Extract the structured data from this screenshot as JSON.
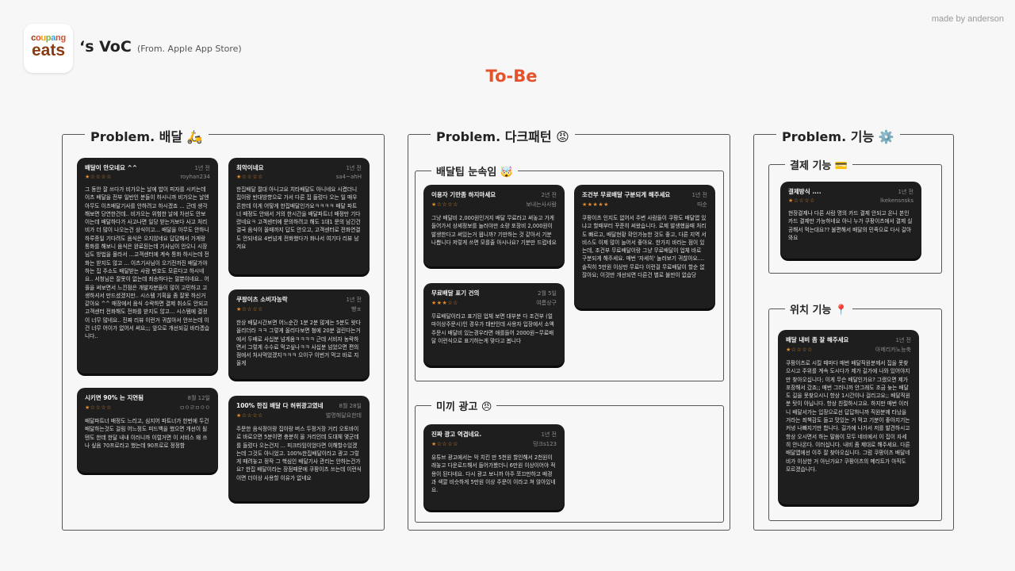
{
  "credit": "made by anderson",
  "logo": {
    "top_letters": [
      "c",
      "o",
      "u",
      "p",
      "a",
      "ng"
    ],
    "bottom": "eats"
  },
  "header": {
    "title": "‘s VoC",
    "subtitle": "(From. Apple App Store)"
  },
  "tobe": "To-Be",
  "colors": {
    "accent": "#e5532d",
    "card_bg": "#1e1e1e",
    "star": "#e38a2c"
  },
  "panels": {
    "delivery": {
      "title": "Problem. 배달 🛵"
    },
    "dark": {
      "title": "Problem. 다크패턴 😡",
      "tip_title": "배달팁 눈속임 🤯",
      "ads_title": "미끼 광고 😠"
    },
    "feature": {
      "title": "Problem. 기능 ⚙️",
      "payment_title": "결제 기능 💳",
      "location_title": "위치 기능 📍"
    }
  },
  "reviews": {
    "r1": {
      "title": "배달이 안오네요 ^^",
      "date": "1년 전",
      "stars": "★☆☆☆☆",
      "rating": 1,
      "author": "royhan234",
      "body": "그 동안 잘 쓰다가 비가오는 날에 밥이 피자를 시키는데 이츠 배달을 전부 일반인 분들이 하시니까 비가오는 날엔 아무도 이츠배달기사를 안하려고 하시겠죠 ... 근데 생각해보면 당연한건데.. 비가오는 위험한 날에 차선도 안보이는데 배달하다가 사고나면 일당 받는거보다 사고 처리비가 더 많이 나오는건 상식이고... 배달을 아무도 안하니 하루종일 기다려도 음식은 오지않네요 답답해서 가게랑 통화를 해보니 음식은 완료된는데 기사님이 안오니 시장님도 방법을 몰라서 ...고객센터에 계속 통화 하시는데 전화는 받지도 않고 ... 이츠기사님이 오기전까진 배달가야하는 집 주소도 배달받는 사람 번호도 모른다고 하시네요.. 서청님은 잘못이 없는데 죄송하다는 말뿐이네요.. 어플을 써보면서 느낀점은 개발자분들이 많이 고민하고 고생하셔서 만드셨겠지만.. 시스템 기획을 좀 잘못 하신거 같아요 ^^ 매장에서 음식 수락하면 결제 취소도 안되고 고객센터 전화해도 전화를 받지도 않고... 시스템에 결정이 너무 많네요.. 진짜 리뷰 이런거 귀찮아서 안쓰는데 이건 너무 어이가 없어서 써요;;; 앞으로 개선되길 바라겠습니다.."
    },
    "r2": {
      "title": "시키면 90% 는 지연됨",
      "date": "8월 12일",
      "stars": "★☆☆☆☆",
      "rating": 1,
      "author": "ㅁㅇㄹㅁㅇㅇ",
      "body": "배달파트너 배정도 느리고, 심지어 파트너가 한번에 두건 배달하는것도 걸림 어느정도 피드백을 했으면 개선이 될텐도 한데 한달 내내 이러니까 이럴거면 이 서비스 왜 쓰나 싶음 70프로라고 했는데 90프로로 정정함"
    },
    "r3": {
      "title": "최악이네요",
      "date": "1년 전",
      "stars": "★☆☆☆☆",
      "rating": 1,
      "author": "sa4~ahH",
      "body": "한집배달 절대 아니고요 치타배달도 아니네요 시켰더니 집이랑 반대방향으로 가서 다른 집 들렀다 오는 일 매우 흔한데 이게 어떻게 한집배달인가요ㅋㅋㅋㅋ 배달 파트너 배정도 안돼서 거의 한시간을 배달파트너 배정만 기다렸네요ㅋ 고객센터에 문의하려고 해도 1대1 문의 남긴건 결국 음식이 올때까지 답도 안오고, 고객센터로 전화연결도 안되네요 4번넘게 전화했다가 화나서 여기다 리뷰 남겨요"
    },
    "r4": {
      "title": "쿠팡이츠 소비자농락",
      "date": "1년 전",
      "stars": "★☆☆☆☆",
      "rating": 1,
      "author": "빵ㅍ",
      "body": "한상 배달시간보면 어느순간 1분 2분 많게는 5분도 왓다 올리더라 ㅋㅋ 그렇게 올리다보면 첨에 20분 걸린다는거에서 두배로 사십분 넘게옴ㅋㅋㅋㅋ 근데 서비자 농락하면서 그렇게 수수료 먹고싶나ㅋㅋ 사십분 넘었으면 편의점에서 처사먹었겠지ㅋㅋㅋ 으이구 이번거 먹고 바로 지울게"
    },
    "r5": {
      "title": "100% 한집 배달 다 허위광고였네",
      "date": "8월 28일",
      "stars": "★☆☆☆☆",
      "rating": 1,
      "author": "벌명해달요한데",
      "body": "주문한 음식정이랑 집이랑 버스 두정거장 거리 오토바이로 바로오면 5분이면 충분히 올 거리인데 도대체 몇군데를 들렀다 오는건지 ... 피크타임이었다면 이해할수있겠는데 그것도 아니었고. 100%한집배달이라고 광고 그렇게 때려놓고 정작 그 핵심인 배달기사 관리는 안하는건가요? 한집 배달이라는 장점때문에 쿠팡이츠 쓰는데 이런식이면 더이상 사용할 이유가 없네요"
    },
    "r6": {
      "title": "이용자 기만좀 하지마세요",
      "date": "2년 전",
      "stars": "★☆☆☆☆",
      "rating": 1,
      "author": "보내는사사람",
      "body": "그냥 배달비 2,000원인거지 배달 무료라고 써놓고 가게 들어가서 상세정보를 눌러야만 소량 포장비 2,000원이 발생한다고 써있는거 뭡니까? 기만하는 것 같아서 기분 나쁩니다 저렇게 쓰면 모를줄 아시나요? 기분만 드럽네요"
    },
    "r7": {
      "title": "무료배달 표기 건의",
      "date": "2월 5일",
      "stars": "★★★☆☆",
      "rating": 3,
      "author": "여름상구",
      "body": "무료배달이라고 표기된 업체 보면 대부분 다 조건부 (얼마이상주문시)인 경우가 태반인데 사용자 입장에서 소액주문시 배달비 있는경우라면 애를들어 2000원~무료배달 이런식으로 표기하는게 맞다고 봅니다"
    },
    "r8": {
      "title": "조건부 무료배달 구분되게 해주세요",
      "date": "1년 전",
      "stars": "★★★★★",
      "rating": 5,
      "author": "따순",
      "body": "쿠팡이츠 인지도 없어서 주변 사람들이 쿠팡도 배달앱 있냐고 할때부터 꾸준히 써왔습니다. 로제 발생했을때 처리도 빠르고, 배달현황 확인가능한 것도 좋고, 다른 지역 서비스도 이제 많이 늘어서 좋아요. 한가지 바라는 점이 있는데, 조건부 무료배달이랑 그냥 무료배달이 업체 바로 구분되게 해주세요. 매번 '자세히' 눌러보기 귀찮아요.... 솔직히 5만원 이상만 무료다 이런걸 무료배달이 할순 없잖아요; 이것만 개선되면 다른건 별로 불만이 없습당"
    },
    "r9": {
      "title": "진짜 광고 역겹네요.",
      "date": "1년 전",
      "stars": "★☆☆☆☆",
      "rating": 1,
      "author": "덩크s123",
      "body": "유튜브 광고에서는 막 치킨 만 5천원 할인해서 2천원이래놓고 다운로드해서 들어가봤더니 6만원 이상이어야 적용이 된다네요. 다시 광고 보니까 아주 쪼끄만하고 배경과 색깔 비슷하게 5만원 이상 주문이 이라고 쳐 앉아있네요."
    },
    "r10": {
      "title": "결제방식 ....",
      "date": "1년 전",
      "stars": "★☆☆☆☆",
      "rating": 1,
      "author": "lkekensnsks",
      "body": "현장결제나 다른 사람 명의 카드 결제 안되고 온니 본인 카드 결제만 가능하네요 아니 누가 쿠팡이츠에서 결제 실공해서 먹는대요?? 불편해서 배달의 민족으로 다시 갈아와요"
    },
    "r11": {
      "title": "배달 내비 좀 잘 해주세요",
      "date": "1년 전",
      "stars": "★☆☆☆☆",
      "rating": 1,
      "author": "아메리카노능축",
      "body": "쿠팡이츠로 시킬 때마다 매번 배달직원분께서 집을 못찾으시고 주위를 계속 도시다가 제가 길가에 나와 있어야지만 찾아오십니다; 이게 무슨 배달인가요? 그랬으면 제가 포장해서 갔죠;; 매번 그러니까 안그래도 조금 늦는 배달도 길을 못찾으시니 항상 1시간이나 걸리고요;; 배달직원분 탓이 아닙니다. 항상 친절하시고요. 하지만 매번 이러니 배달서가는 입장으로선 답답하니까 직원분께 타났을 거라는 죄책감도 들고 맛있는 거 먹고 기분이 좋아지기는 커녕 나빠지기만 합니다. 길가에 나가서 저를 발견하시고 항상 오시면서 하는 말씀이 모두 네비에서 이 집이 자세히 안나온다. 이러십니다. 내비 좀 제대로 해주세요. 다른 배달앱에선 이주 잘 찾아오십니다. 그럼 쿠팡이츠 배달네비가 이상한 거 아닌가요? 쿠팡이츠의 메리트가 아직도 모르겠습니다."
    }
  }
}
